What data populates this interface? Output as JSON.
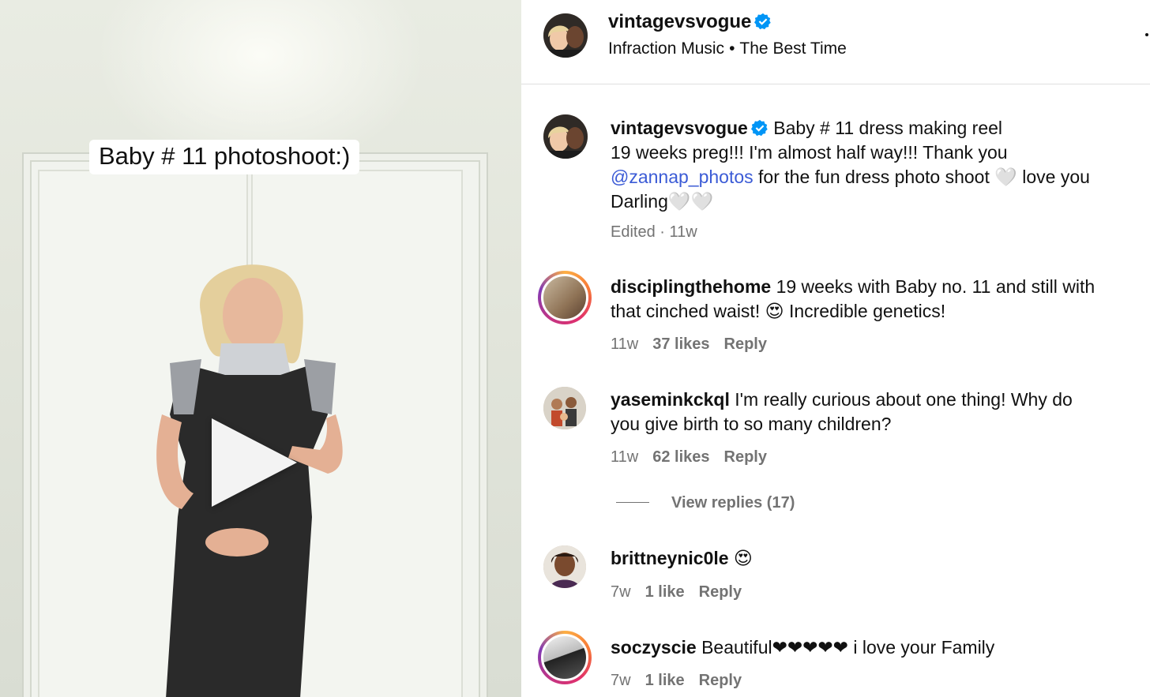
{
  "media": {
    "overlay_text": "Baby # 11 photoshoot:)"
  },
  "header": {
    "username": "vintagevsvogue",
    "audio_artist": "Infraction Music",
    "separator": "•",
    "audio_track": "The Best Time"
  },
  "caption": {
    "username": "vintagevsvogue",
    "line1": "Baby # 11 dress making reel",
    "line2": "19 weeks preg!!! I'm almost half way!!! Thank you",
    "mention": "@zannap_photos",
    "line3_rest": " for the fun dress photo shoot 🤍 love you",
    "line4": "Darling🤍🤍",
    "meta": "Edited · 11w"
  },
  "comments": [
    {
      "username": "disciplingthehome",
      "text_a": " 19 weeks with Baby no. 11 and still with",
      "text_b": "that cinched waist! 😍 Incredible genetics!",
      "time": "11w",
      "likes": "37 likes",
      "reply": "Reply"
    },
    {
      "username": "yaseminkckql",
      "text_a": " I'm really curious about one thing! Why do",
      "text_b": "you give birth to so many children?",
      "time": "11w",
      "likes": "62 likes",
      "reply": "Reply",
      "view_replies": "View replies (17)"
    },
    {
      "username": "brittneynic0le",
      "text_a": " 😍",
      "time": "7w",
      "likes": "1 like",
      "reply": "Reply"
    },
    {
      "username": "soczyscie",
      "text_a": " Beautiful❤❤❤❤❤ i love your Family",
      "time": "7w",
      "likes": "1 like",
      "reply": "Reply"
    }
  ],
  "colors": {
    "verified": "#0095f6",
    "mention": "#3b5bd6",
    "muted": "#737373"
  }
}
